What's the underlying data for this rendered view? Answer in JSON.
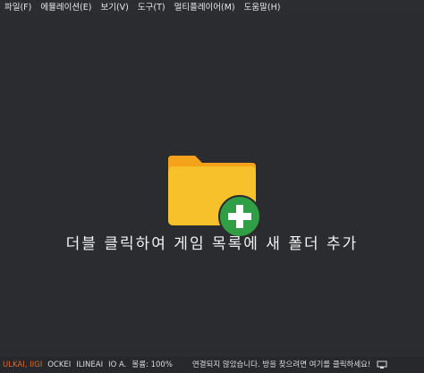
{
  "menu": {
    "items": [
      {
        "label": "파일(F)"
      },
      {
        "label": "에뮬레이션(E)"
      },
      {
        "label": "보기(V)"
      },
      {
        "label": "도구(T)"
      },
      {
        "label": "멀티플레이어(M)"
      },
      {
        "label": "도움말(H)"
      }
    ]
  },
  "main": {
    "empty_hint": "더블 클릭하여 게임 목록에 새 폴더 추가",
    "icon": "folder-add-icon",
    "colors": {
      "folder": "#f7c12c",
      "folder_tab": "#f6a21b",
      "plus_badge": "#2f9e44"
    }
  },
  "status": {
    "backend": "ULKAI, IIGI",
    "shader": "OCKEI",
    "filter": "ILINEAI",
    "audio": "IO A.",
    "volume": "볼륨: 100%",
    "message": "연결되지 않았습니다. 방을 찾으려면 여기를 클릭하세요!"
  }
}
